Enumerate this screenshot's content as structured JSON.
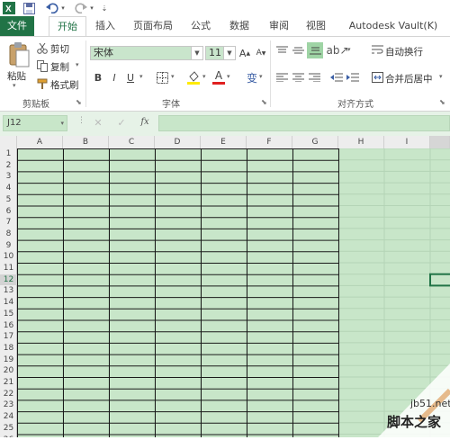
{
  "qat": {
    "icons": [
      "excel-logo-icon",
      "save-icon",
      "undo-icon",
      "redo-icon",
      "customize-icon"
    ]
  },
  "tabs": [
    {
      "label": "文件",
      "name": "tab-file"
    },
    {
      "label": "开始",
      "name": "tab-home"
    },
    {
      "label": "插入",
      "name": "tab-insert"
    },
    {
      "label": "页面布局",
      "name": "tab-page-layout"
    },
    {
      "label": "公式",
      "name": "tab-formulas"
    },
    {
      "label": "数据",
      "name": "tab-data"
    },
    {
      "label": "审阅",
      "name": "tab-review"
    },
    {
      "label": "视图",
      "name": "tab-view"
    },
    {
      "label": "Autodesk Vault(K)",
      "name": "tab-autodesk-vault"
    }
  ],
  "clipboard": {
    "paste": "粘贴",
    "cut": "剪切",
    "copy": "复制",
    "format_painter": "格式刷",
    "group": "剪贴板"
  },
  "font": {
    "name": "宋体",
    "size": "11",
    "group": "字体",
    "bold": "B",
    "italic": "I",
    "underline": "U",
    "font_color_letter": "A",
    "wen": "变"
  },
  "alignment": {
    "wrap": "自动换行",
    "merge": "合并后居中",
    "group": "对齐方式"
  },
  "formula_bar": {
    "cell_ref": "J12",
    "fx": "fx",
    "cancel": "✕",
    "enter": "✓"
  },
  "sheet": {
    "columns": [
      "A",
      "B",
      "C",
      "D",
      "E",
      "F",
      "G",
      "H",
      "I"
    ],
    "rows": [
      "1",
      "2",
      "3",
      "4",
      "5",
      "6",
      "7",
      "8",
      "9",
      "10",
      "11",
      "12",
      "13",
      "14",
      "15",
      "16",
      "17",
      "18",
      "19",
      "20",
      "21",
      "22",
      "23",
      "24",
      "25",
      "26"
    ],
    "active_row": "12"
  },
  "watermark": {
    "site": "jb51.net",
    "brand": "脚本之家"
  },
  "colors": {
    "accent": "#217346",
    "cell_bg": "#c8e6c9"
  }
}
